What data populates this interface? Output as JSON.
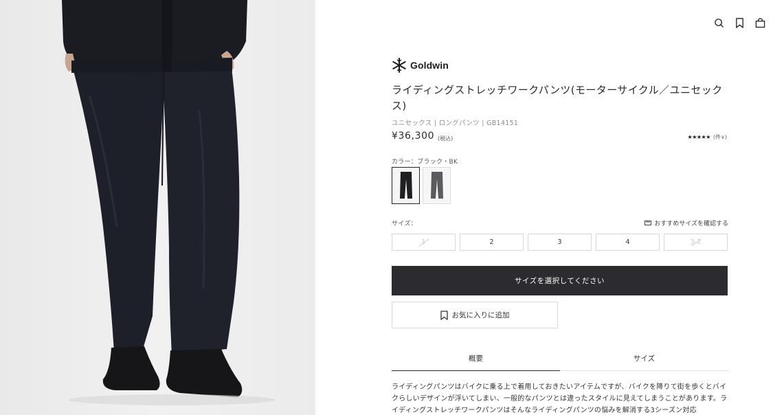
{
  "header": {
    "icons": [
      "search-icon",
      "bookmark-icon",
      "shopping-bag-icon"
    ]
  },
  "product": {
    "brand": "Goldwin",
    "title": "ライディングストレッチワークパンツ(モーターサイクル／ユニセックス)",
    "meta": "ユニセックス | ロングパンツ | GB14151",
    "price": "¥36,300",
    "tax_note": "(税込)",
    "rating_stars": "★★★★★",
    "rating_count": "(件∨)",
    "color_label": "カラー：ブラック・BK",
    "swatches": [
      {
        "color": "#1e1f22",
        "selected": true
      },
      {
        "color": "#5a5b5e",
        "selected": false
      }
    ],
    "size_label": "サイズ：",
    "size_guide": "おすすめサイズを確認する",
    "sizes": [
      {
        "label": "1",
        "available": false
      },
      {
        "label": "2",
        "available": true
      },
      {
        "label": "3",
        "available": true
      },
      {
        "label": "4",
        "available": true
      },
      {
        "label": "3-2",
        "available": false
      }
    ],
    "cart_button": "サイズを選択してください",
    "favorite_button": "お気に入りに追加",
    "tabs": [
      {
        "label": "概要",
        "active": true
      },
      {
        "label": "サイズ",
        "active": false
      }
    ],
    "description": "ライディングパンツはバイクに乗る上で着用しておきたいアイテムですが、バイクを降りて街を歩くとバイクらしいデザインが浮いてしまい、一般的なパンツとは違ったスタイルに見えてしまうことがあります。ライディングストレッチワークパンツはそんなライディングパンツの悩みを解消する3シーズン対応"
  },
  "colors": {
    "primary_button": "#2b2b30",
    "border": "#d8d8d8",
    "text": "#2b2b2b",
    "muted": "#8c8c8c"
  }
}
